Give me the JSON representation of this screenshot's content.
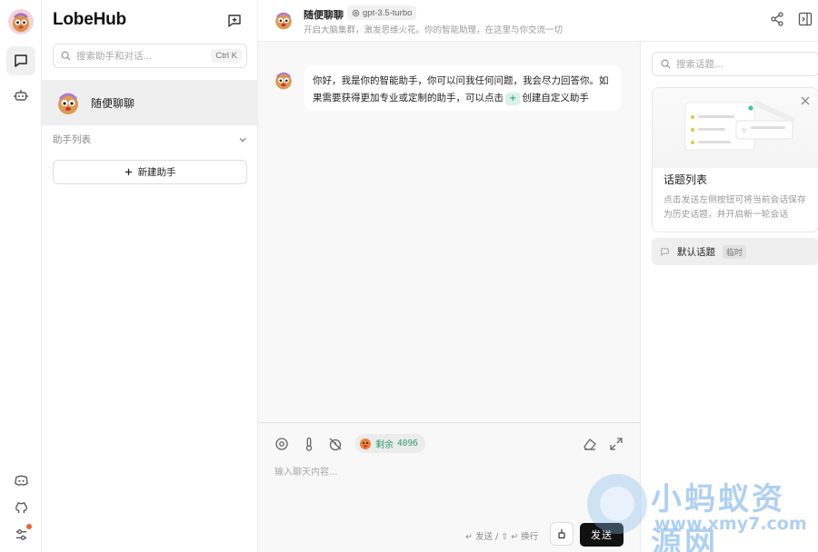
{
  "app": {
    "brand": "LobeHub"
  },
  "rail": {
    "items": [
      "chat-icon",
      "robot-icon",
      "discord-icon",
      "github-icon",
      "settings-icon"
    ]
  },
  "sessions": {
    "search_placeholder": "搜索助手和对话...",
    "search_shortcut": "Ctrl K",
    "active_session": "随便聊聊",
    "group_label": "助手列表",
    "new_assistant_label": "新建助手"
  },
  "header": {
    "title": "随便聊聊",
    "model": "gpt-3.5-turbo",
    "description": "开启大脑集群，激发思维火花。你的智能助理，在这里与你交流一切"
  },
  "messages": [
    {
      "role": "assistant",
      "text_before": "你好，我是你的智能助手，你可以问我任何问题，我会尽力回答你。如果需要获得更加专业或定制的助手，可以点击",
      "chip": "+",
      "text_after": "创建自定义助手"
    }
  ],
  "input": {
    "token_label": "剩余",
    "token_count": "4096",
    "placeholder": "输入聊天内容...",
    "hint": "↵ 发送 / ⇧ ↵ 换行",
    "send_label": "发送"
  },
  "topics": {
    "search_placeholder": "搜索话题...",
    "guide_title": "话题列表",
    "guide_desc": "点击发送左侧按钮可将当前会话保存为历史话题，并开启新一轮会话",
    "default_topic": "默认话题",
    "default_badge": "临时"
  },
  "watermark": {
    "text": "小蚂蚁资源网",
    "url": "www.xmy7.com"
  },
  "colors": {
    "accent_green": "#2f9c6c",
    "send_bg": "#111111",
    "notify_dot": "#e8623a"
  }
}
